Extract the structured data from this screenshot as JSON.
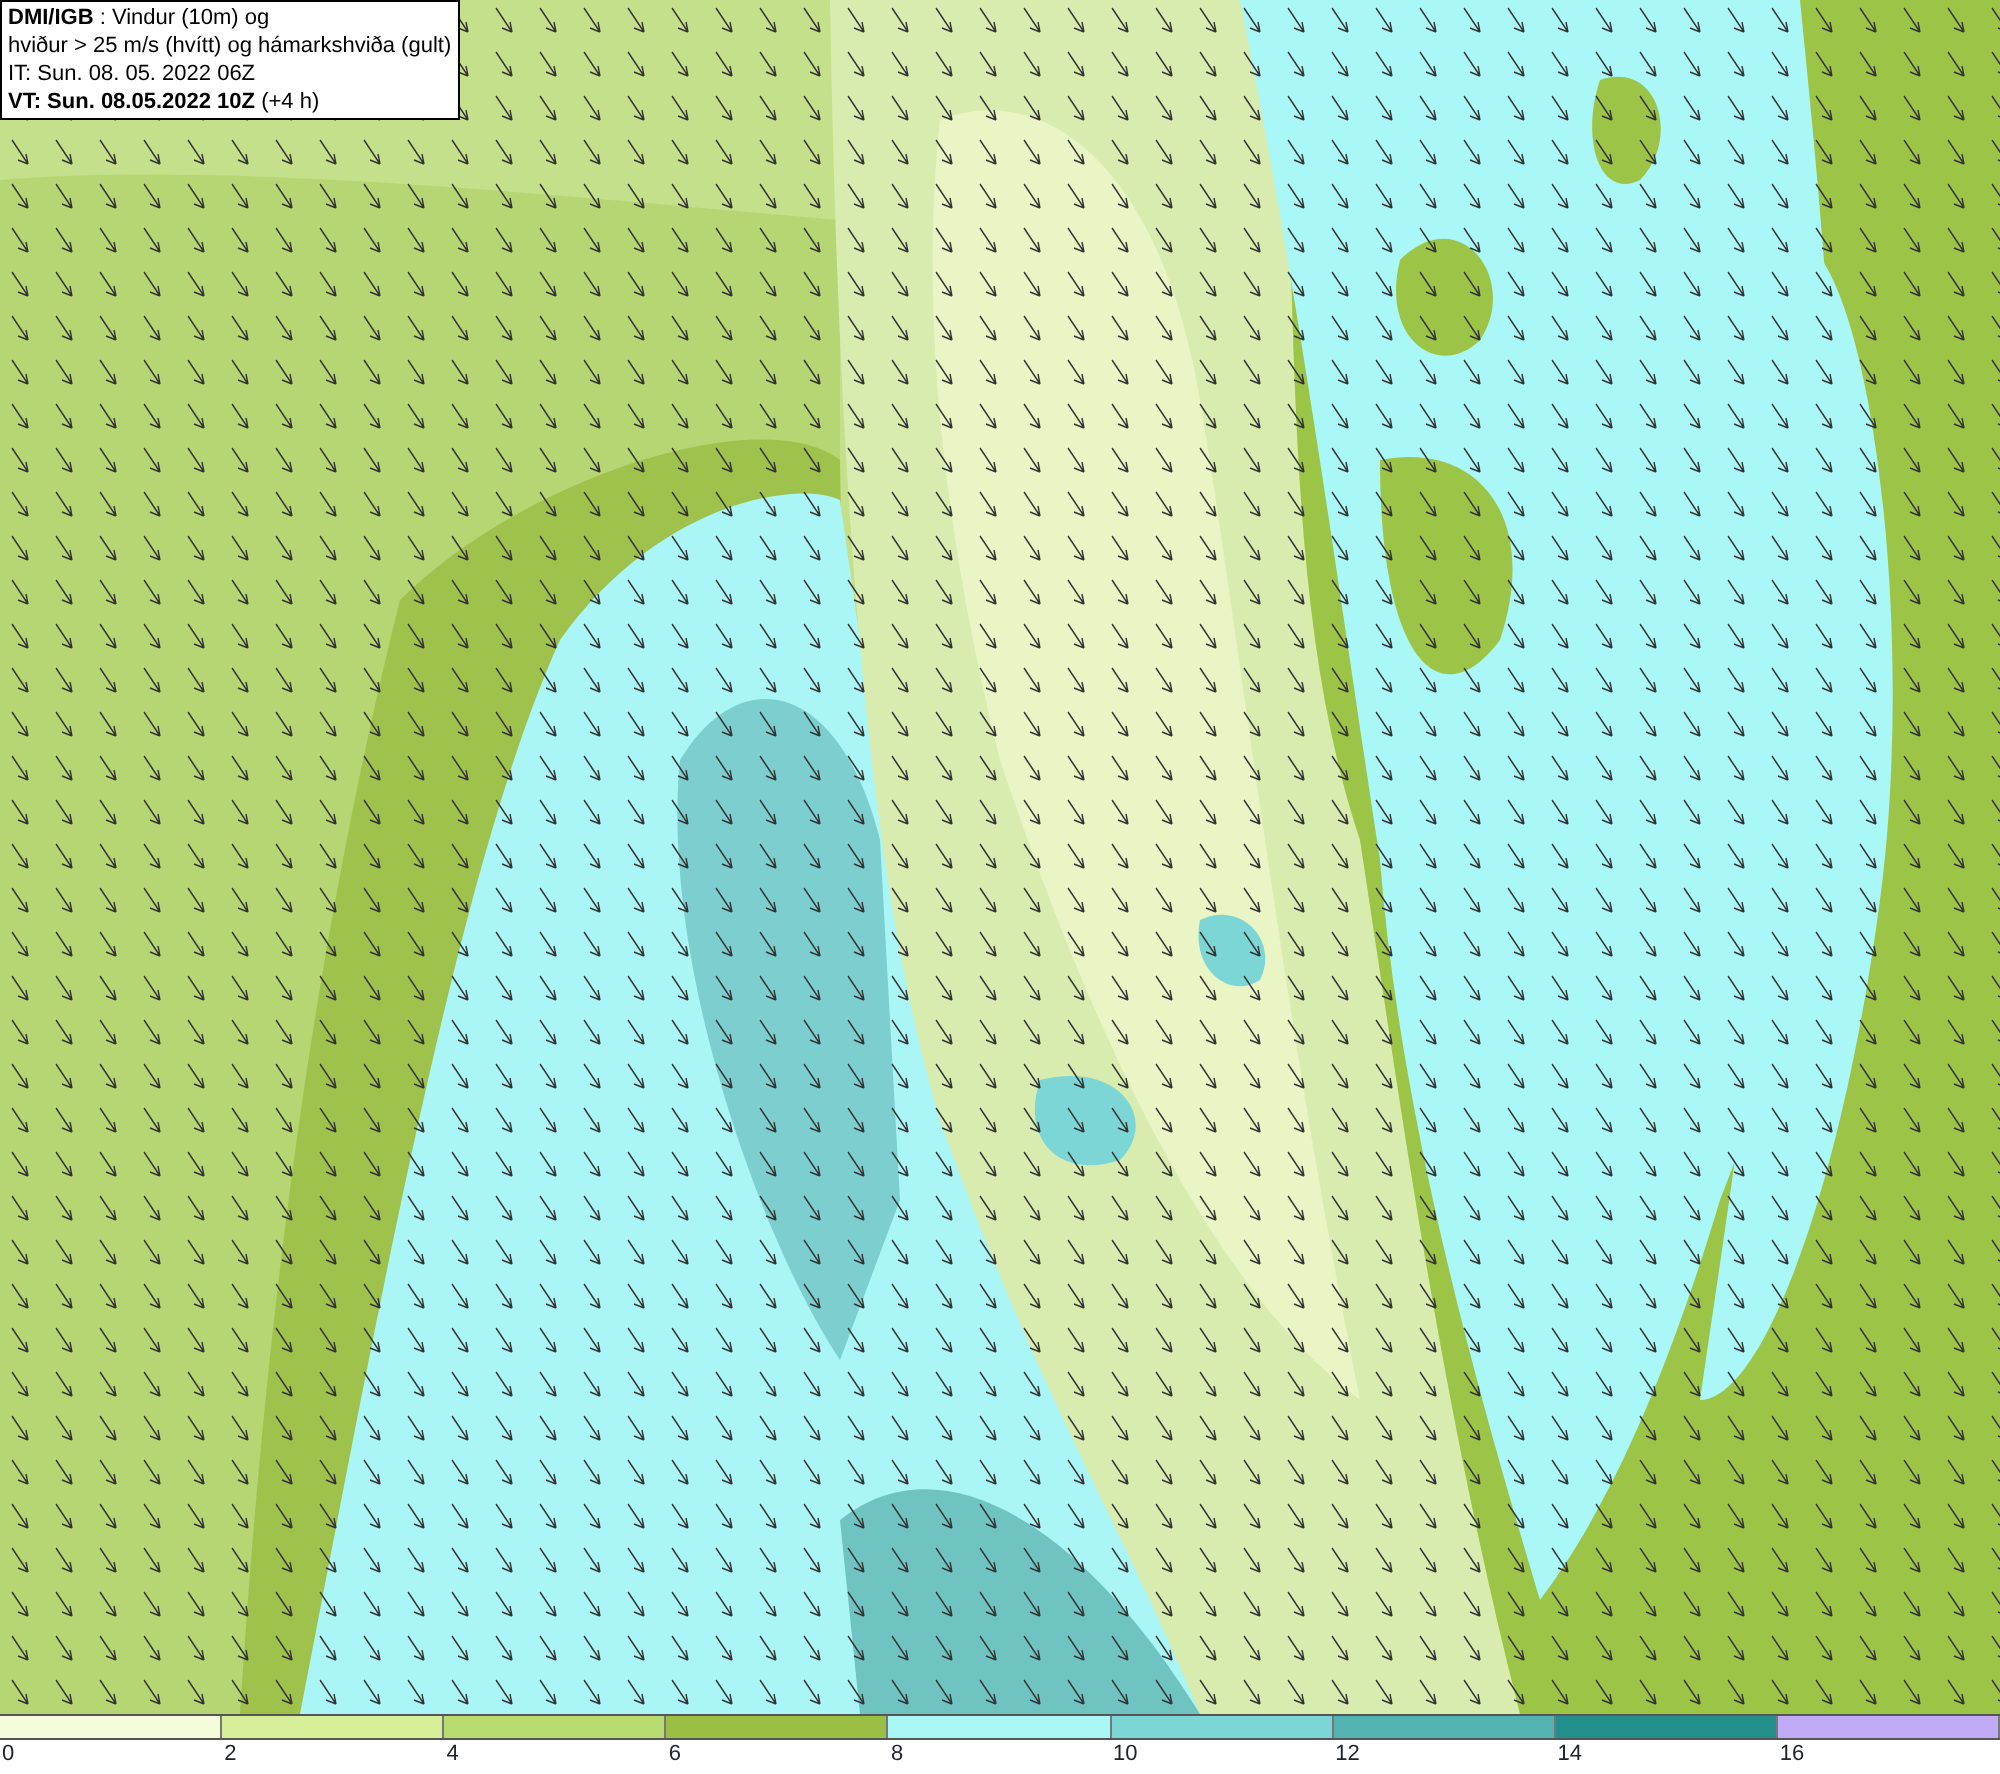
{
  "title_box": {
    "lines": [
      "**DMI/IGB** : Vindur (10m) og",
      "hviður > 25 m/s (hvítt) og hámarkshviða (gult)",
      "IT: Sun. 08. 05. 2022 06Z",
      "**VT: Sun. 08.05.2022 10Z** (+4 h)"
    ]
  },
  "legend": {
    "segments": [
      {
        "label": "0",
        "color": "#f4fcd9"
      },
      {
        "label": "2",
        "color": "#d6ef98"
      },
      {
        "label": "4",
        "color": "#b8dc70"
      },
      {
        "label": "6",
        "color": "#9abf44"
      },
      {
        "label": "8",
        "color": "#aaf7f7"
      },
      {
        "label": "10",
        "color": "#7dd6d6"
      },
      {
        "label": "12",
        "color": "#52b3b0"
      },
      {
        "label": "14",
        "color": "#228f8a"
      },
      {
        "label": "16",
        "color": "#c0aaf5"
      }
    ]
  }
}
